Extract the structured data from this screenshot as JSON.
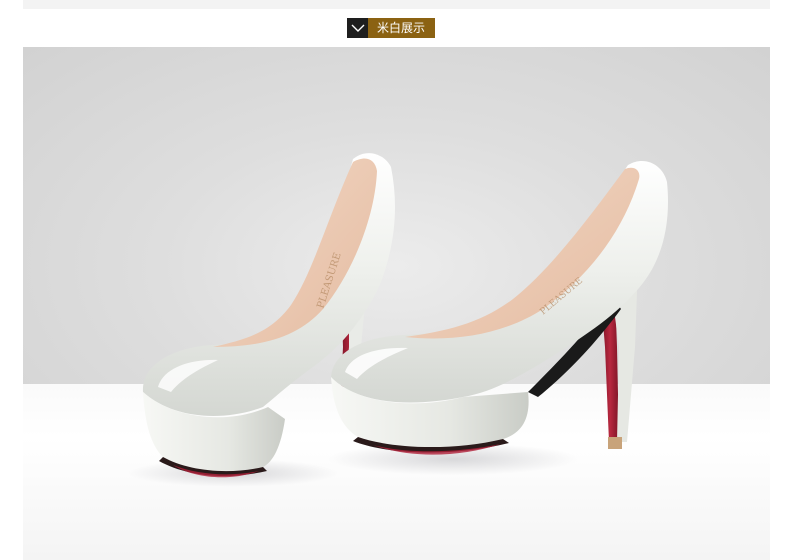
{
  "header": {
    "section_title": "米白展示"
  },
  "icons": {
    "tag_icon": "chevron-down-icon"
  },
  "colors": {
    "tag_dark": "#1e1e1e",
    "tag_brown": "#8b6212",
    "shoe_white": "#eceeea",
    "sole_red": "#b0203a"
  }
}
